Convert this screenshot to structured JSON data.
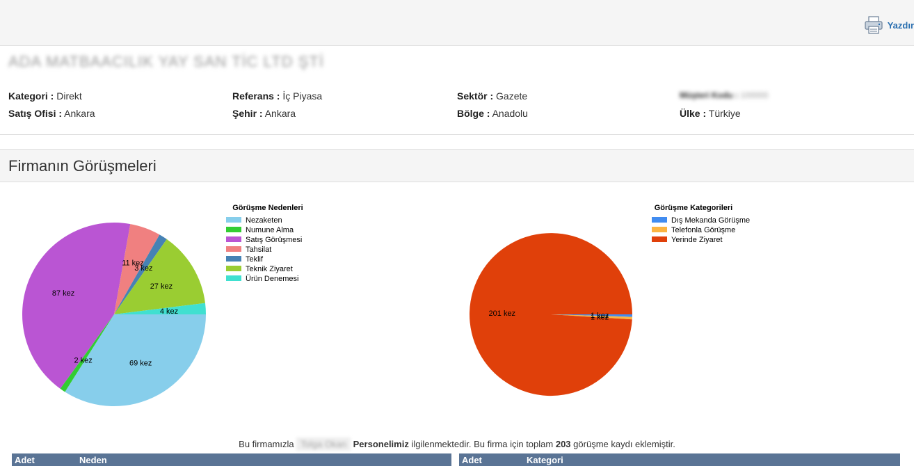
{
  "header": {
    "print_label": "Yazdır",
    "print_icon": "printer-icon"
  },
  "company": {
    "name": "ADA MATBAACILIK YAY SAN TİC LTD ŞTİ"
  },
  "info": {
    "kategori": {
      "label": "Kategori :",
      "value": "Direkt"
    },
    "referans": {
      "label": "Referans :",
      "value": "İç Piyasa"
    },
    "sektor": {
      "label": "Sektör :",
      "value": "Gazete"
    },
    "musteri_kodu": {
      "label": "Müşteri Kodu :",
      "value": "100000"
    },
    "satis_ofisi": {
      "label": "Satış Ofisi :",
      "value": "Ankara"
    },
    "sehir": {
      "label": "Şehir :",
      "value": "Ankara"
    },
    "bolge": {
      "label": "Bölge :",
      "value": "Anadolu"
    },
    "ulke": {
      "label": "Ülke :",
      "value": "Türkiye"
    }
  },
  "section": {
    "title": "Firmanın Görüşmeleri"
  },
  "chart_data": [
    {
      "type": "pie",
      "title": "Görüşme Nedenleri",
      "legend_position": "right",
      "slices": [
        {
          "label": "Nezaketen",
          "value": 69,
          "text": "69 kez",
          "color": "#87ceeb"
        },
        {
          "label": "Numune Alma",
          "value": 2,
          "text": "2 kez",
          "color": "#32cd32"
        },
        {
          "label": "Satış Görüşmesi",
          "value": 87,
          "text": "87 kez",
          "color": "#ba55d3"
        },
        {
          "label": "Tahsilat",
          "value": 11,
          "text": "11 kez",
          "color": "#f08080"
        },
        {
          "label": "Teklif",
          "value": 3,
          "text": "3 kez",
          "color": "#4682b4"
        },
        {
          "label": "Teknik Ziyaret",
          "value": 27,
          "text": "27 kez",
          "color": "#9acd32"
        },
        {
          "label": "Ürün Denemesi",
          "value": 4,
          "text": "4 kez",
          "color": "#40e0d0"
        }
      ]
    },
    {
      "type": "pie",
      "title": "Görüşme Kategorileri",
      "legend_position": "right",
      "slices": [
        {
          "label": "Dış Mekanda Görüşme",
          "value": 1,
          "text": "1 kez",
          "color": "#418cf0"
        },
        {
          "label": "Telefonla Görüşme",
          "value": 1,
          "text": "1 kez",
          "color": "#fcb441"
        },
        {
          "label": "Yerinde Ziyaret",
          "value": 201,
          "text": "201 kez",
          "color": "#e0400a"
        }
      ]
    }
  ],
  "summary": {
    "prefix": "Bu firmamızla",
    "person": "Tolga Okan",
    "personel": "Personelimiz",
    "middle": "ilgilenmektedir. Bu firma için toplam",
    "total": "203",
    "suffix": "görüşme kaydı eklemiştir."
  },
  "tables": {
    "left": {
      "col1": "Adet",
      "col2": "Neden"
    },
    "right": {
      "col1": "Adet",
      "col2": "Kategori"
    }
  }
}
